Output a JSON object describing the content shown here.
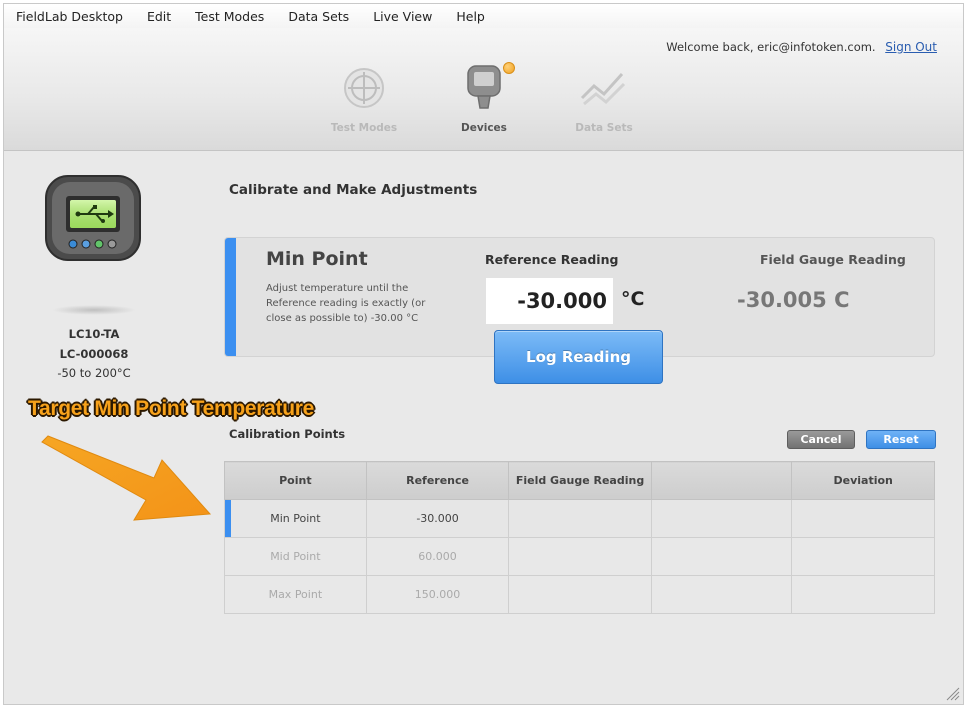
{
  "menu": [
    "FieldLab Desktop",
    "Edit",
    "Test Modes",
    "Data Sets",
    "Live View",
    "Help"
  ],
  "header": {
    "welcome": "Welcome back, eric@infotoken.com.",
    "sign_out": "Sign Out",
    "nav": [
      {
        "label": "Test Modes",
        "icon": "crosshair-icon",
        "state": "inactive"
      },
      {
        "label": "Devices",
        "icon": "device-icon",
        "state": "active",
        "badge": true
      },
      {
        "label": "Data Sets",
        "icon": "chart-icon",
        "state": "inactive"
      }
    ]
  },
  "device": {
    "model": "LC10-TA",
    "serial": "LC-000068",
    "range": "-50 to 200°C",
    "icon": "usb-device-icon"
  },
  "main": {
    "title": "Calibrate and Make Adjustments",
    "card": {
      "point_title": "Min Point",
      "instructions": "Adjust temperature until the Reference reading is exactly (or close as possible to) -30.00 °C",
      "reference_label": "Reference Reading",
      "reference_value": "-30.000",
      "reference_unit": "°C",
      "field_gauge_label": "Field Gauge Reading",
      "field_gauge_value": "-30.005 C"
    },
    "log_button": "Log Reading",
    "annotation": "Target Min Point Temperature",
    "calibration": {
      "title": "Calibration Points",
      "cancel": "Cancel",
      "reset": "Reset",
      "columns": [
        "Point",
        "Reference",
        "Field Gauge Reading",
        "",
        "Deviation"
      ],
      "rows": [
        {
          "point": "Min Point",
          "reference": "-30.000",
          "field_gauge": "",
          "extra": "",
          "deviation": "",
          "active": true
        },
        {
          "point": "Mid Point",
          "reference": "60.000",
          "field_gauge": "",
          "extra": "",
          "deviation": "",
          "active": false
        },
        {
          "point": "Max Point",
          "reference": "150.000",
          "field_gauge": "",
          "extra": "",
          "deviation": "",
          "active": false
        }
      ]
    }
  },
  "colors": {
    "accent": "#3b8ff0",
    "annotation": "#f7a21b",
    "badge": "#f0a020"
  }
}
